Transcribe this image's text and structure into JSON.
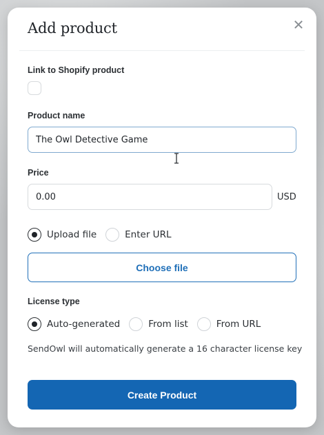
{
  "modal": {
    "title": "Add product",
    "close_icon": "close-icon"
  },
  "shopify": {
    "label": "Link to Shopify product",
    "checked": false
  },
  "product_name": {
    "label": "Product name",
    "value": "The Owl Detective Game"
  },
  "price": {
    "label": "Price",
    "value": "0.00",
    "currency": "USD"
  },
  "file_source": {
    "options": [
      "Upload file",
      "Enter URL"
    ],
    "selected": "Upload file"
  },
  "choose_file": {
    "label": "Choose file"
  },
  "license": {
    "label": "License type",
    "options": [
      "Auto-generated",
      "From list",
      "From URL"
    ],
    "selected": "Auto-generated",
    "help_text": "SendOwl will automatically generate a 16 character license key"
  },
  "create_button": {
    "label": "Create Product"
  },
  "colors": {
    "primary": "#1466b3",
    "outline_accent": "#1f6fb8",
    "focus_border": "#7fa9cf"
  }
}
